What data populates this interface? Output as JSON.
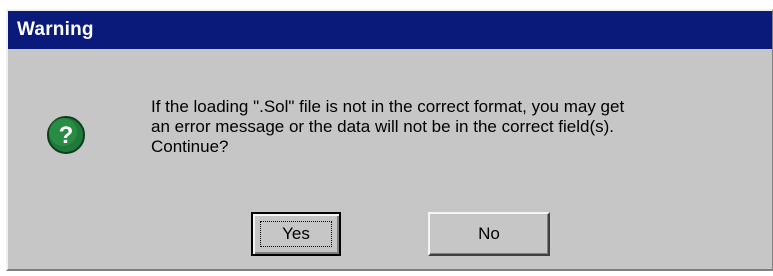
{
  "window": {
    "title": "Warning"
  },
  "dialog": {
    "icon": "question-icon",
    "icon_glyph": "?",
    "message_lines": [
      "If the loading \".Sol\" file is not in the correct format, you may get",
      "an error message or the data will not be in the correct field(s).",
      "Continue?"
    ],
    "buttons": {
      "yes_label": "Yes",
      "no_label": "No"
    }
  },
  "colors": {
    "titlebar": "#0a1a7a",
    "dialog_face": "#c6c6c6",
    "icon_fill": "#1f7a3a"
  }
}
